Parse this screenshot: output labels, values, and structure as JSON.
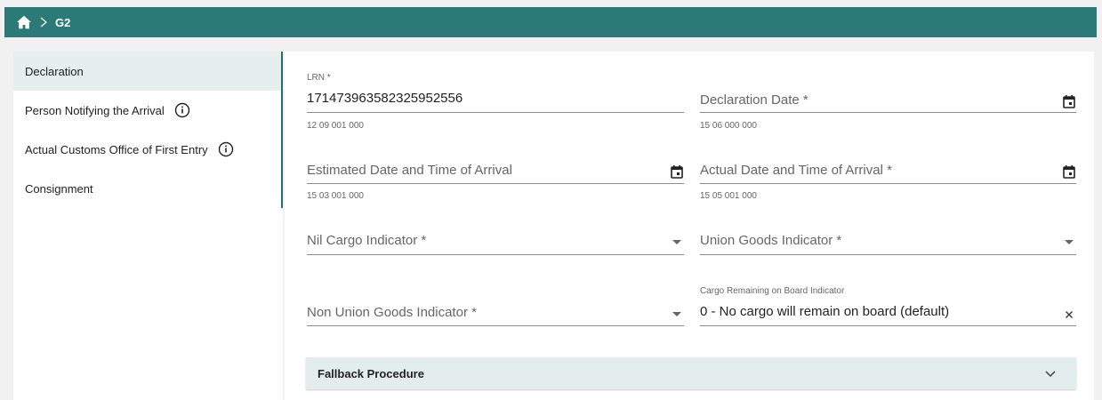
{
  "colors": {
    "topbar": "#2b7a78",
    "accent": "#1f6f6c",
    "active_item": "#e6eeee",
    "panel": "#e3eded"
  },
  "breadcrumb": {
    "home_icon": "home-icon",
    "separator_icon": "chevron-right-icon",
    "current": "G2"
  },
  "sidebar": {
    "items": [
      {
        "label": "Declaration",
        "active": true
      },
      {
        "label": "Person Notifying the Arrival",
        "info": true
      },
      {
        "label": "Actual Customs Office of First Entry",
        "info": true
      },
      {
        "label": "Consignment"
      }
    ]
  },
  "form": {
    "lrn": {
      "label": "LRN *",
      "value": "17147396358232595255​6",
      "hint": "12 09 001 000"
    },
    "declaration_date": {
      "placeholder": "Declaration Date *",
      "hint": "15 06 000 000",
      "icon": "calendar-icon"
    },
    "estimated_arrival": {
      "placeholder": "Estimated Date and Time of Arrival",
      "hint": "15 03 001 000",
      "icon": "calendar-icon"
    },
    "actual_arrival": {
      "placeholder": "Actual Date and Time of Arrival *",
      "hint": "15 05 001 000",
      "icon": "calendar-icon"
    },
    "nil_cargo": {
      "placeholder": "Nil Cargo Indicator *",
      "icon": "dropdown-arrow-icon"
    },
    "union_goods": {
      "placeholder": "Union Goods Indicator *",
      "icon": "dropdown-arrow-icon"
    },
    "non_union_goods": {
      "placeholder": "Non Union Goods Indicator *",
      "icon": "dropdown-arrow-icon"
    },
    "cargo_remaining": {
      "label": "Cargo Remaining on Board Indicator",
      "value": "0 - No cargo will remain on board (default)",
      "icon": "clear-icon"
    }
  },
  "fallback": {
    "title": "Fallback Procedure",
    "icon": "chevron-down-icon"
  }
}
